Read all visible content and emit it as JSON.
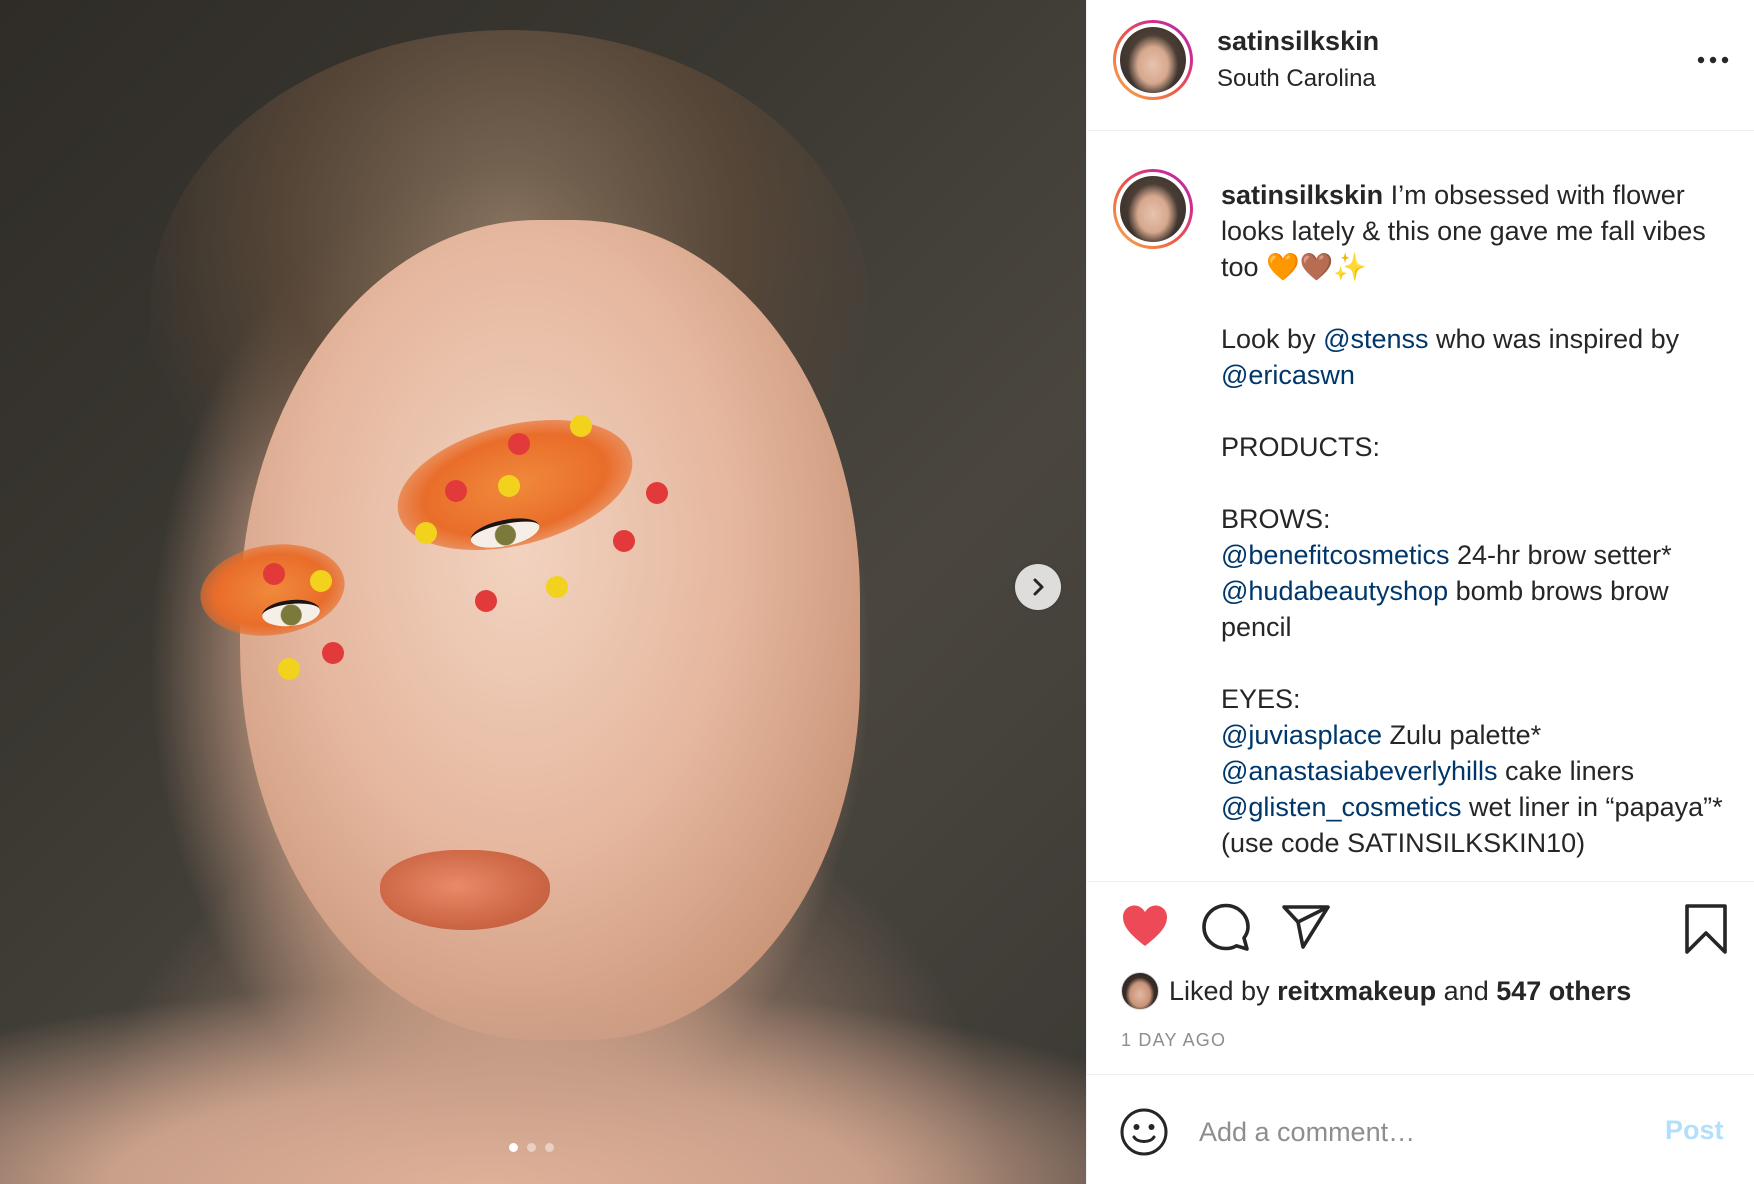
{
  "post": {
    "username": "satinsilkskin",
    "location": "South Carolina",
    "more_icon": "more-horizontal-icon",
    "carousel": {
      "current": 1,
      "total": 3,
      "next_icon": "chevron-right-icon"
    }
  },
  "caption": {
    "username": "satinsilkskin",
    "intro": " I’m obsessed with flower looks lately & this one gave me fall vibes too 🧡🤎✨",
    "look_by_prefix": "Look by ",
    "look_by_mention": "@stenss",
    "inspired_text": " who was inspired by ",
    "inspired_mention": "@ericaswn",
    "products_heading": "PRODUCTS:",
    "brows_heading": "BROWS:",
    "brows": [
      {
        "mention": "@benefitcosmetics",
        "text": " 24-hr brow setter*"
      },
      {
        "mention": "@hudabeautyshop",
        "text": " bomb brows brow pencil"
      }
    ],
    "eyes_heading": "EYES:",
    "eyes": [
      {
        "mention": "@juviasplace",
        "text": " Zulu palette*"
      },
      {
        "mention": "@anastasiabeverlyhills",
        "text": " cake liners"
      },
      {
        "mention": "@glisten_cosmetics",
        "text": " wet liner in “papaya”* (use code SATINSILKSKIN10)"
      }
    ]
  },
  "actions": {
    "like_icon": "heart-filled-icon",
    "comment_icon": "comment-icon",
    "share_icon": "paper-plane-icon",
    "save_icon": "bookmark-icon",
    "like_color": "#ed4956"
  },
  "likes": {
    "prefix": "Liked by ",
    "user": "reitxmakeup",
    "middle": " and ",
    "others": "547 others"
  },
  "timestamp": "1 DAY AGO",
  "comment": {
    "emoji_icon": "smiley-icon",
    "placeholder": "Add a comment…",
    "post_label": "Post"
  }
}
